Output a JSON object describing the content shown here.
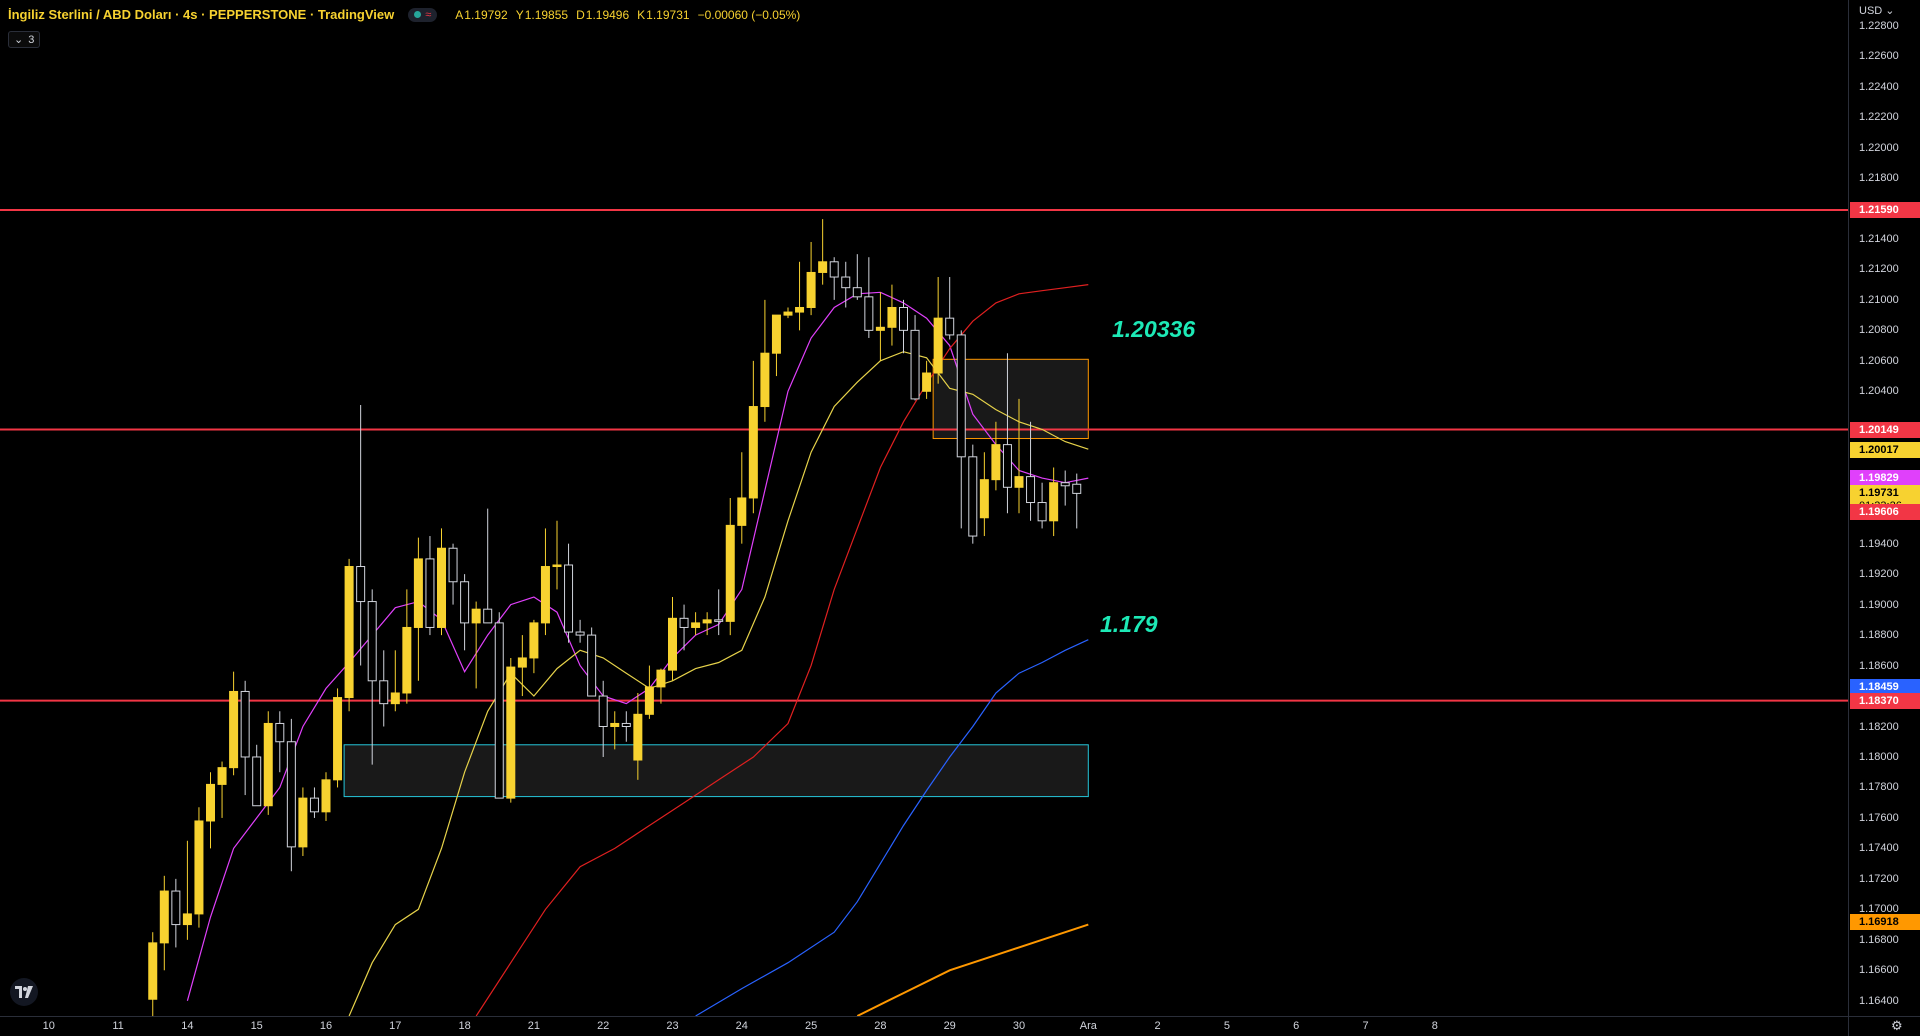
{
  "legend": {
    "title": "İngiliz Sterlini / ABD Doları · 4s · PEPPERSTONE · TradingView",
    "open_label": "A",
    "open": "1.19792",
    "high_label": "Y",
    "high": "1.19855",
    "low_label": "D",
    "low": "1.19496",
    "close_label": "K",
    "close": "1.19731",
    "change": "−0.00060 (−0.05%)",
    "indicator_count": "3"
  },
  "price_axis": {
    "currency": "USD",
    "ticks": [
      "1.22800",
      "1.22600",
      "1.22400",
      "1.22200",
      "1.22000",
      "1.21800",
      "1.21400",
      "1.21200",
      "1.21000",
      "1.20800",
      "1.20600",
      "1.20400",
      "1.19400",
      "1.19200",
      "1.19000",
      "1.18800",
      "1.18600",
      "1.18200",
      "1.18000",
      "1.17800",
      "1.17600",
      "1.17400",
      "1.17200",
      "1.17000",
      "1.16800",
      "1.16600",
      "1.16400"
    ],
    "badges": [
      {
        "label": "1.21590",
        "price": 1.2159,
        "bg": "#f23645",
        "fg": "#ffffff"
      },
      {
        "label": "1.20149",
        "price": 1.20149,
        "bg": "#f23645",
        "fg": "#ffffff"
      },
      {
        "label": "1.20017",
        "price": 1.20017,
        "bg": "#f7d230",
        "fg": "#000000"
      },
      {
        "label": "1.19829",
        "price": 1.19829,
        "bg": "#e040fb",
        "fg": "#ffffff"
      },
      {
        "label": "1.19731",
        "price": 1.19731,
        "bg": "#f7d230",
        "fg": "#000000",
        "sub": "01:33:26"
      },
      {
        "label": "1.19606",
        "price": 1.19606,
        "bg": "#f23645",
        "fg": "#ffffff"
      },
      {
        "label": "1.18459",
        "price": 1.18459,
        "bg": "#2962ff",
        "fg": "#ffffff"
      },
      {
        "label": "1.18370",
        "price": 1.1837,
        "bg": "#f23645",
        "fg": "#ffffff"
      },
      {
        "label": "1.16918",
        "price": 1.16918,
        "bg": "#ff9800",
        "fg": "#000000"
      }
    ]
  },
  "time_axis": {
    "ticks": [
      {
        "label": "10",
        "idx": -4
      },
      {
        "label": "11",
        "idx": 2
      },
      {
        "label": "14",
        "idx": 8
      },
      {
        "label": "15",
        "idx": 14
      },
      {
        "label": "16",
        "idx": 20
      },
      {
        "label": "17",
        "idx": 26
      },
      {
        "label": "18",
        "idx": 32
      },
      {
        "label": "21",
        "idx": 38
      },
      {
        "label": "22",
        "idx": 44
      },
      {
        "label": "23",
        "idx": 50
      },
      {
        "label": "24",
        "idx": 56
      },
      {
        "label": "25",
        "idx": 62
      },
      {
        "label": "28",
        "idx": 68
      },
      {
        "label": "29",
        "idx": 74
      },
      {
        "label": "30",
        "idx": 80
      },
      {
        "label": "Ara",
        "idx": 86
      },
      {
        "label": "2",
        "idx": 92
      },
      {
        "label": "5",
        "idx": 98
      },
      {
        "label": "6",
        "idx": 104
      },
      {
        "label": "7",
        "idx": 110
      },
      {
        "label": "8",
        "idx": 116
      }
    ]
  },
  "annotations": {
    "resistance_label": "1.20336",
    "support_label": "1.179"
  },
  "colors": {
    "bull": "#f7d230",
    "bear_body": "#000000",
    "bear_border": "#d1d4dc",
    "hline": "#f23645",
    "ma_magenta": "#e040fb",
    "ma_yellow": "#e6d24a",
    "ma_red": "#e02020",
    "ma_blue": "#2962ff",
    "ma_orange": "#ff9800",
    "zone_resistance": "#ff9800",
    "zone_support": "#26c6da"
  },
  "chart_data": {
    "type": "candlestick",
    "symbol": "GBPUSD",
    "timeframe": "4s",
    "ylim": [
      1.163,
      1.2285
    ],
    "horizontal_lines": [
      1.2159,
      1.20149,
      1.1837
    ],
    "zones": [
      {
        "name": "resistance",
        "from_idx": 73,
        "to_idx": 86,
        "top": 1.2061,
        "bottom": 1.2009
      },
      {
        "name": "support",
        "from_idx": 22,
        "to_idx": 86,
        "top": 1.1808,
        "bottom": 1.1774
      }
    ],
    "candles": [
      [
        1.1641,
        1.1685,
        1.163,
        1.1678
      ],
      [
        1.1678,
        1.1722,
        1.166,
        1.1712
      ],
      [
        1.1712,
        1.172,
        1.1675,
        1.169
      ],
      [
        1.169,
        1.1745,
        1.168,
        1.1697
      ],
      [
        1.1697,
        1.1767,
        1.1688,
        1.1758
      ],
      [
        1.1758,
        1.179,
        1.174,
        1.1782
      ],
      [
        1.1782,
        1.1797,
        1.176,
        1.1793
      ],
      [
        1.1793,
        1.1856,
        1.1788,
        1.1843
      ],
      [
        1.1843,
        1.185,
        1.1775,
        1.18
      ],
      [
        1.18,
        1.1808,
        1.1768,
        1.1768
      ],
      [
        1.1768,
        1.183,
        1.1762,
        1.1822
      ],
      [
        1.1822,
        1.183,
        1.179,
        1.181
      ],
      [
        1.181,
        1.1825,
        1.1725,
        1.1741
      ],
      [
        1.1741,
        1.178,
        1.1735,
        1.1773
      ],
      [
        1.1773,
        1.178,
        1.176,
        1.1764
      ],
      [
        1.1764,
        1.179,
        1.1758,
        1.1785
      ],
      [
        1.1785,
        1.1845,
        1.178,
        1.1839
      ],
      [
        1.1839,
        1.193,
        1.183,
        1.1925
      ],
      [
        1.1925,
        1.2031,
        1.186,
        1.1902
      ],
      [
        1.1902,
        1.191,
        1.1795,
        1.185
      ],
      [
        1.185,
        1.187,
        1.182,
        1.1835
      ],
      [
        1.1835,
        1.187,
        1.183,
        1.1842
      ],
      [
        1.1842,
        1.191,
        1.1835,
        1.1885
      ],
      [
        1.1885,
        1.1944,
        1.185,
        1.193
      ],
      [
        1.193,
        1.1945,
        1.188,
        1.1885
      ],
      [
        1.1885,
        1.195,
        1.188,
        1.1937
      ],
      [
        1.1937,
        1.194,
        1.19,
        1.1915
      ],
      [
        1.1915,
        1.192,
        1.187,
        1.1888
      ],
      [
        1.1888,
        1.1902,
        1.1845,
        1.1897
      ],
      [
        1.1897,
        1.1963,
        1.189,
        1.1888
      ],
      [
        1.1888,
        1.1895,
        1.1773,
        1.1773
      ],
      [
        1.1773,
        1.1865,
        1.177,
        1.1859
      ],
      [
        1.1859,
        1.188,
        1.184,
        1.1865
      ],
      [
        1.1865,
        1.189,
        1.1855,
        1.1888
      ],
      [
        1.1888,
        1.195,
        1.188,
        1.1925
      ],
      [
        1.1925,
        1.1955,
        1.191,
        1.1926
      ],
      [
        1.1926,
        1.194,
        1.1875,
        1.1882
      ],
      [
        1.1882,
        1.189,
        1.1875,
        1.188
      ],
      [
        1.188,
        1.1885,
        1.184,
        1.184
      ],
      [
        1.184,
        1.185,
        1.18,
        1.182
      ],
      [
        1.182,
        1.183,
        1.1805,
        1.1822
      ],
      [
        1.1822,
        1.183,
        1.181,
        1.182
      ],
      [
        1.1798,
        1.1842,
        1.1785,
        1.1828
      ],
      [
        1.1828,
        1.186,
        1.1825,
        1.1846
      ],
      [
        1.1846,
        1.1858,
        1.1835,
        1.1857
      ],
      [
        1.1857,
        1.1905,
        1.185,
        1.1891
      ],
      [
        1.1891,
        1.19,
        1.187,
        1.1885
      ],
      [
        1.1885,
        1.1895,
        1.188,
        1.1888
      ],
      [
        1.1888,
        1.1895,
        1.188,
        1.189
      ],
      [
        1.189,
        1.191,
        1.188,
        1.1889
      ],
      [
        1.1889,
        1.197,
        1.188,
        1.1952
      ],
      [
        1.1952,
        1.2,
        1.194,
        1.197
      ],
      [
        1.197,
        1.206,
        1.196,
        1.203
      ],
      [
        1.203,
        1.21,
        1.202,
        1.2065
      ],
      [
        1.2065,
        1.209,
        1.205,
        1.209
      ],
      [
        1.209,
        1.2095,
        1.2088,
        1.2092
      ],
      [
        1.2092,
        1.2125,
        1.208,
        1.2095
      ],
      [
        1.2095,
        1.2138,
        1.209,
        1.2118
      ],
      [
        1.2118,
        1.2153,
        1.211,
        1.2125
      ],
      [
        1.2125,
        1.2128,
        1.21,
        1.2115
      ],
      [
        1.2115,
        1.2125,
        1.2095,
        1.2108
      ],
      [
        1.2108,
        1.213,
        1.21,
        1.2102
      ],
      [
        1.2102,
        1.2128,
        1.2075,
        1.208
      ],
      [
        1.208,
        1.2105,
        1.206,
        1.2082
      ],
      [
        1.2082,
        1.211,
        1.207,
        1.2095
      ],
      [
        1.2095,
        1.21,
        1.2065,
        1.208
      ],
      [
        1.208,
        1.209,
        1.2034,
        1.2035
      ],
      [
        1.204,
        1.206,
        1.2035,
        1.2052
      ],
      [
        1.2052,
        1.2115,
        1.2045,
        1.2088
      ],
      [
        1.2088,
        1.2115,
        1.2074,
        1.2077
      ],
      [
        1.2077,
        1.208,
        1.195,
        1.1997
      ],
      [
        1.1997,
        1.2005,
        1.194,
        1.1945
      ],
      [
        1.1957,
        1.2,
        1.1945,
        1.1982
      ],
      [
        1.1982,
        1.202,
        1.1975,
        1.2005
      ],
      [
        1.2005,
        1.2065,
        1.196,
        1.1977
      ],
      [
        1.1977,
        1.2035,
        1.196,
        1.1984
      ],
      [
        1.1984,
        1.202,
        1.1955,
        1.1967
      ],
      [
        1.1967,
        1.198,
        1.195,
        1.1955
      ],
      [
        1.1955,
        1.199,
        1.1945,
        1.198
      ],
      [
        1.198,
        1.1988,
        1.1965,
        1.1978
      ],
      [
        1.1979,
        1.1986,
        1.195,
        1.1973
      ]
    ],
    "candles_start_idx": 5,
    "ma_series": [
      {
        "color": "#e040fb",
        "values": [
          [
            8,
            1.164
          ],
          [
            10,
            1.1695
          ],
          [
            12,
            1.174
          ],
          [
            14,
            1.176
          ],
          [
            16,
            1.178
          ],
          [
            18,
            1.182
          ],
          [
            20,
            1.1845
          ],
          [
            22,
            1.1862
          ],
          [
            24,
            1.188
          ],
          [
            26,
            1.1898
          ],
          [
            28,
            1.1902
          ],
          [
            30,
            1.189
          ],
          [
            32,
            1.1856
          ],
          [
            34,
            1.188
          ],
          [
            36,
            1.19
          ],
          [
            38,
            1.1905
          ],
          [
            40,
            1.1895
          ],
          [
            42,
            1.186
          ],
          [
            44,
            1.184
          ],
          [
            46,
            1.1835
          ],
          [
            48,
            1.1845
          ],
          [
            50,
            1.1865
          ],
          [
            52,
            1.188
          ],
          [
            54,
            1.1887
          ],
          [
            56,
            1.191
          ],
          [
            58,
            1.1975
          ],
          [
            60,
            1.204
          ],
          [
            62,
            1.2075
          ],
          [
            64,
            1.2095
          ],
          [
            66,
            1.2104
          ],
          [
            68,
            1.2105
          ],
          [
            70,
            1.2098
          ],
          [
            72,
            1.2088
          ],
          [
            74,
            1.207
          ],
          [
            76,
            1.2025
          ],
          [
            78,
            1.2005
          ],
          [
            80,
            1.1988
          ],
          [
            82,
            1.1983
          ],
          [
            84,
            1.198
          ],
          [
            86,
            1.1983
          ]
        ]
      },
      {
        "color": "#e6d24a",
        "values": [
          [
            22,
            1.163
          ],
          [
            24,
            1.1665
          ],
          [
            26,
            1.169
          ],
          [
            28,
            1.17
          ],
          [
            30,
            1.174
          ],
          [
            32,
            1.179
          ],
          [
            34,
            1.183
          ],
          [
            36,
            1.1855
          ],
          [
            38,
            1.184
          ],
          [
            40,
            1.1858
          ],
          [
            42,
            1.187
          ],
          [
            44,
            1.1865
          ],
          [
            46,
            1.1855
          ],
          [
            48,
            1.1845
          ],
          [
            50,
            1.185
          ],
          [
            52,
            1.1858
          ],
          [
            54,
            1.1862
          ],
          [
            56,
            1.187
          ],
          [
            58,
            1.1905
          ],
          [
            60,
            1.1955
          ],
          [
            62,
            1.2
          ],
          [
            64,
            1.203
          ],
          [
            66,
            1.2046
          ],
          [
            68,
            1.206
          ],
          [
            70,
            1.2066
          ],
          [
            72,
            1.2062
          ],
          [
            74,
            1.2042
          ],
          [
            76,
            1.2038
          ],
          [
            78,
            1.2028
          ],
          [
            80,
            1.202
          ],
          [
            82,
            1.2015
          ],
          [
            84,
            1.2007
          ],
          [
            86,
            1.2002
          ]
        ]
      },
      {
        "color": "#e02020",
        "values": [
          [
            33,
            1.163
          ],
          [
            36,
            1.1665
          ],
          [
            39,
            1.17
          ],
          [
            42,
            1.1728
          ],
          [
            45,
            1.174
          ],
          [
            48,
            1.1755
          ],
          [
            51,
            1.177
          ],
          [
            54,
            1.1785
          ],
          [
            57,
            1.18
          ],
          [
            60,
            1.1822
          ],
          [
            62,
            1.186
          ],
          [
            64,
            1.191
          ],
          [
            66,
            1.195
          ],
          [
            68,
            1.199
          ],
          [
            70,
            1.202
          ],
          [
            72,
            1.2045
          ],
          [
            74,
            1.2068
          ],
          [
            76,
            1.2086
          ],
          [
            78,
            1.2098
          ],
          [
            80,
            1.2104
          ],
          [
            82,
            1.2106
          ],
          [
            84,
            1.2108
          ],
          [
            86,
            1.211
          ]
        ]
      },
      {
        "color": "#2962ff",
        "values": [
          [
            52,
            1.163
          ],
          [
            56,
            1.1648
          ],
          [
            60,
            1.1665
          ],
          [
            64,
            1.1685
          ],
          [
            66,
            1.1705
          ],
          [
            68,
            1.173
          ],
          [
            70,
            1.1755
          ],
          [
            72,
            1.1778
          ],
          [
            74,
            1.18
          ],
          [
            76,
            1.182
          ],
          [
            78,
            1.1842
          ],
          [
            80,
            1.1855
          ],
          [
            82,
            1.1862
          ],
          [
            84,
            1.187
          ],
          [
            86,
            1.1877
          ]
        ]
      },
      {
        "color": "#ff9800",
        "values": [
          [
            66,
            1.163
          ],
          [
            70,
            1.1645
          ],
          [
            74,
            1.166
          ],
          [
            78,
            1.167
          ],
          [
            82,
            1.168
          ],
          [
            86,
            1.169
          ]
        ]
      }
    ]
  }
}
